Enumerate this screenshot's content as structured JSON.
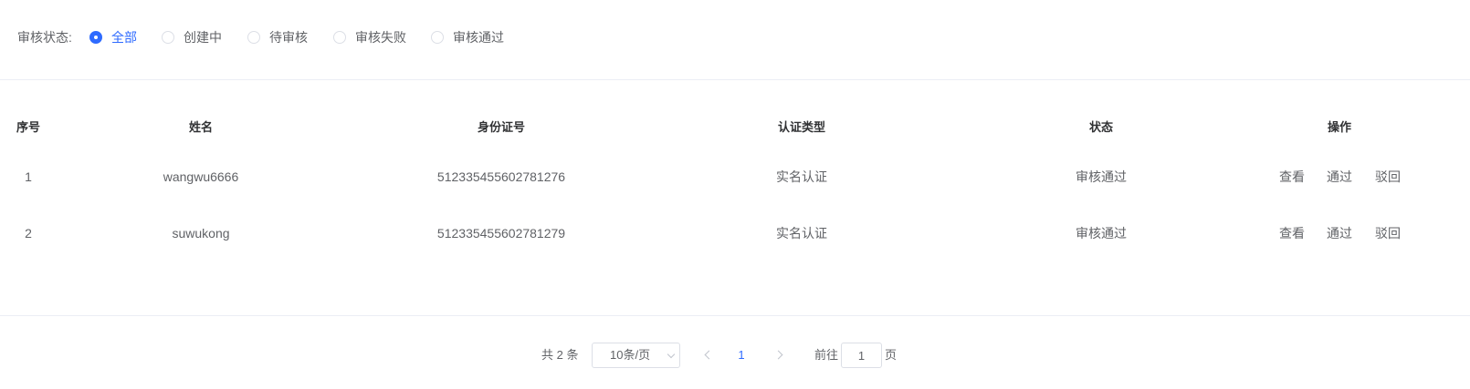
{
  "filter": {
    "label": "审核状态:",
    "options": [
      {
        "label": "全部",
        "checked": true
      },
      {
        "label": "创建中",
        "checked": false
      },
      {
        "label": "待审核",
        "checked": false
      },
      {
        "label": "审核失败",
        "checked": false
      },
      {
        "label": "审核通过",
        "checked": false
      }
    ]
  },
  "table": {
    "columns": [
      "序号",
      "姓名",
      "身份证号",
      "认证类型",
      "状态",
      "操作"
    ],
    "rows": [
      {
        "index": "1",
        "name": "wangwu6666",
        "id_number": "512335455602781276",
        "auth_type": "实名认证",
        "status": "审核通过"
      },
      {
        "index": "2",
        "name": "suwukong",
        "id_number": "512335455602781279",
        "auth_type": "实名认证",
        "status": "审核通过"
      }
    ],
    "actions": {
      "view": "查看",
      "pass": "通过",
      "reject": "驳回"
    }
  },
  "pagination": {
    "total": "共 2 条",
    "page_size": "10条/页",
    "current_page": "1",
    "goto_label": "前往",
    "goto_value": "1",
    "goto_suffix": "页"
  },
  "colors": {
    "accent": "#2f6bff",
    "pass_disabled": "#b8e6cf",
    "reject_disabled": "#f7c3c3"
  }
}
